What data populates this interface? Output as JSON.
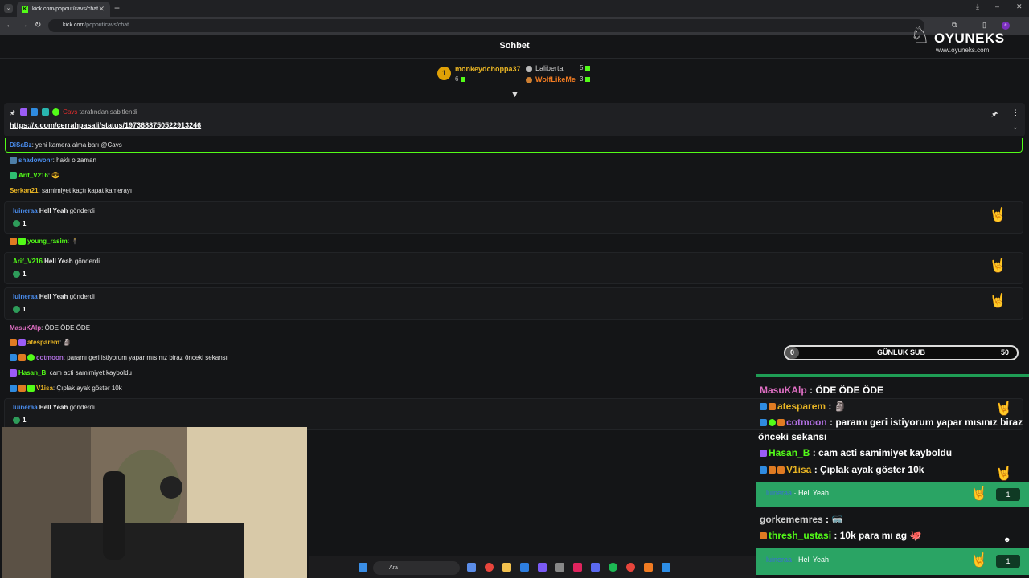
{
  "browser": {
    "tab_title": "kick.com/popout/cavs/chat",
    "tab_favicon": "K",
    "url_host": "kick.com",
    "url_path": "/popout/cavs/chat",
    "profile_initial": "c"
  },
  "watermark": {
    "title": "OYUNEKS",
    "url": "www.oyuneks.com"
  },
  "chat": {
    "title": "Sohbet",
    "leaderboard": [
      {
        "rank": "1",
        "name": "monkeydchoppa37",
        "count": "6"
      },
      {
        "name": "Laliberta",
        "count": "5"
      },
      {
        "name": "WolfLikeMe",
        "count": "3"
      }
    ],
    "pinned": {
      "user": "Cavs",
      "pinned_by": "tarafından sabitlendi",
      "link": "https://x.com/cerrahpasali/status/1973688750522913246"
    },
    "messages": [
      {
        "user": "DiSaBz",
        "text": "yeni kamera alma barı @Cavs"
      },
      {
        "user": "shadowonr",
        "text": "haklı o zaman"
      },
      {
        "user": "Arif_V216",
        "text": ""
      },
      {
        "user": "Serkan21",
        "text": "samimiyet kaçtı kapat kamerayı"
      },
      {
        "user": "young_rasim",
        "text": ""
      },
      {
        "user": "MasuKAlp",
        "text": "ÖDE ÖDE ÖDE"
      },
      {
        "user": "atesparem",
        "text": ""
      },
      {
        "user": "cotmoon",
        "text": "paramı geri istiyorum yapar mısınız biraz önceki sekansı"
      },
      {
        "user": "Hasan_B",
        "text": "cam acti samimiyet kayboldu"
      },
      {
        "user": "V1isa",
        "text": "Çıplak ayak göster 10k"
      }
    ],
    "gifts": [
      {
        "user": "luineraa",
        "item": "Hell Yeah",
        "verb": "gönderdi",
        "count": "1"
      },
      {
        "user": "Arif_V216",
        "item": "Hell Yeah",
        "verb": "gönderdi",
        "count": "1"
      },
      {
        "user": "luineraa",
        "item": "Hell Yeah",
        "verb": "gönderdi",
        "count": "1"
      },
      {
        "user": "luineraa",
        "item": "Hell Yeah",
        "verb": "gönderdi",
        "count": "1"
      }
    ]
  },
  "overlay": {
    "sub_goal": {
      "label": "GÜNLUK SUB",
      "current": "0",
      "target": "50",
      "progress": 0.06
    },
    "messages": [
      {
        "user": "MasuKAlp",
        "text": "ÖDE ÖDE ÖDE"
      },
      {
        "user": "atesparem",
        "text": ""
      },
      {
        "user": "cotmoon",
        "text": "paramı geri istiyorum yapar mısınız biraz"
      },
      {
        "user": "",
        "text": "önceki sekansı"
      },
      {
        "user": "Hasan_B",
        "text": "cam acti samimiyet kayboldu"
      },
      {
        "user": "V1isa",
        "text": "Çıplak ayak göster 10k"
      },
      {
        "user": "gorkememres",
        "text": ""
      },
      {
        "user": "thresh_ustasi",
        "text": "10k para mı ag"
      }
    ],
    "gifts": [
      {
        "user": "luineraa",
        "item": "Hell Yeah",
        "count": "1"
      },
      {
        "user": "luineraa",
        "item": "Hell Yeah",
        "count": "1"
      }
    ]
  },
  "taskbar": {
    "search_placeholder": "Ara"
  },
  "colors": {
    "kick_green": "#53fc18",
    "gift_green": "#2aa464",
    "gold": "#e0a106"
  }
}
